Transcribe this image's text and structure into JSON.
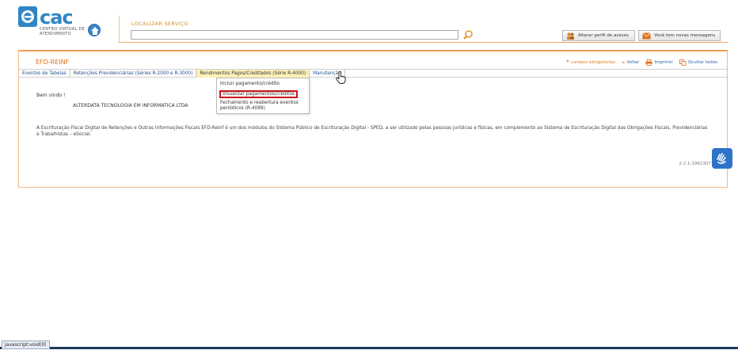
{
  "header": {
    "logo_text": "cac",
    "logo_subtitle": "CENTRO VIRTUAL DE ATENDIMENTO",
    "search_label": "LOCALIZAR SERVIÇO",
    "search_value": "",
    "btn_perfil": "Alterar perfil de acesso",
    "btn_msg": "Você tem novas mensagens"
  },
  "panel": {
    "title": "EFD-REINF",
    "required": "campos obrigatórios",
    "voltar": "Voltar",
    "imprimir": "Imprimir",
    "ocultar": "Ocultar todos"
  },
  "menu": [
    "Eventos de Tabelas",
    "Retenções Previdenciárias (Séries R-2000 e R-3000)",
    "Rendimentos Pagos/Creditados (Série R-4000)",
    "Manutenção"
  ],
  "dropdown": [
    "Incluir pagamento/crédito",
    "Visualizar pagamentos/créditos",
    "Fechamento e reabertura eventos periódicos (R-4099)"
  ],
  "content": {
    "welcome": "Bem vindo !",
    "company": "ALTERDATA TECNOLOGIA EM INFORMATICA LTDA",
    "description": "A Escrituração Fiscal Digital de Retenções e Outras Informações Fiscais EFD-Reinf é um dos módulos do Sistema Público de Escrituração Digital - SPED, a ser utilizado pelas pessoas jurídicas e físicas, em complemento ao Sistema de Escrituração Digital das Obrigações Fiscais, Previdenciárias e Trabalhistas – eSocial.",
    "version": "2.2.1-1962307"
  },
  "status": {
    "text": "javascript:void(0)"
  },
  "colors": {
    "accent": "#e0701e",
    "brand": "#2f86c4",
    "highlight": "#c9141a"
  }
}
